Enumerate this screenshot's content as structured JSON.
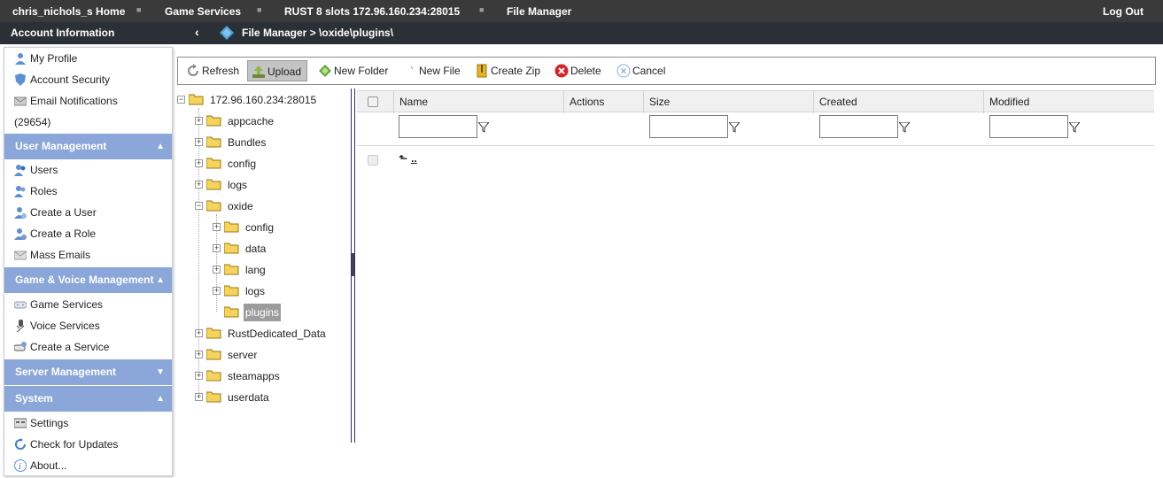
{
  "topbar": {
    "home": "chris_nichols_s Home",
    "game_services": "Game Services",
    "server": "RUST 8 slots 172.96.160.234:28015",
    "file_manager": "File Manager",
    "logout": "Log Out"
  },
  "subbar": {
    "account": "Account Information",
    "path": "File Manager > \\oxide\\plugins\\"
  },
  "sidebar": {
    "account_items": [
      {
        "label": "My Profile",
        "icon": "user-icon"
      },
      {
        "label": "Account Security",
        "icon": "shield-icon"
      },
      {
        "label": "Email Notifications",
        "icon": "mail-icon"
      },
      {
        "label": "(29654)"
      }
    ],
    "user_mgmt": {
      "title": "User Management",
      "items": [
        "Users",
        "Roles",
        "Create a User",
        "Create a Role",
        "Mass Emails"
      ]
    },
    "game_voice": {
      "title": "Game & Voice Management",
      "items": [
        "Game Services",
        "Voice Services",
        "Create a Service"
      ]
    },
    "server_mgmt": {
      "title": "Server Management"
    },
    "system": {
      "title": "System",
      "items": [
        "Settings",
        "Check for Updates",
        "About..."
      ]
    }
  },
  "toolbar": {
    "refresh": "Refresh",
    "upload": "Upload",
    "new_folder": "New Folder",
    "new_file": "New File",
    "create_zip": "Create Zip",
    "delete": "Delete",
    "cancel": "Cancel"
  },
  "tree": {
    "root": "172.96.160.234:28015",
    "level1": [
      "appcache",
      "Bundles",
      "config",
      "logs",
      "oxide"
    ],
    "oxide_children": [
      "config",
      "data",
      "lang",
      "logs",
      "plugins"
    ],
    "level1_after": [
      "RustDedicated_Data",
      "server",
      "steamapps",
      "userdata"
    ],
    "selected": "plugins"
  },
  "grid": {
    "columns": {
      "name": "Name",
      "actions": "Actions",
      "size": "Size",
      "created": "Created",
      "modified": "Modified"
    },
    "up_row_label": ".."
  },
  "colors": {
    "topbar": "#3a3a3a",
    "subbar": "#2a3036",
    "section_header": "#8ba6d9",
    "selected_node": "#9c9c9c"
  }
}
